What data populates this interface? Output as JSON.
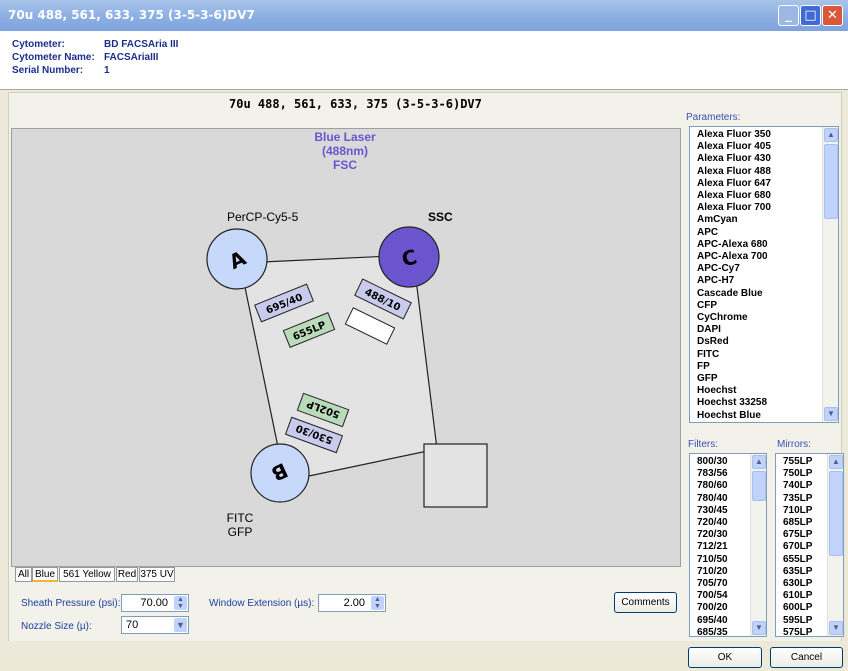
{
  "window": {
    "title": "70u 488, 561, 633, 375 (3-5-3-6)DV7",
    "min": "_",
    "max": "□",
    "close": "✕"
  },
  "info": [
    {
      "label": "Cytometer:",
      "value": "BD FACSAria III"
    },
    {
      "label": "Cytometer Name:",
      "value": "FACSAriaIII"
    },
    {
      "label": "Serial Number:",
      "value": "1"
    }
  ],
  "diagram": {
    "title": "70u 488, 561, 633, 375 (3-5-3-6)DV7",
    "laser_line1": "Blue Laser",
    "laser_line2": "(488nm)",
    "laser_line3": "FSC",
    "label_a": "PerCP-Cy5-5",
    "label_c": "SSC",
    "label_b1": "FITC",
    "label_b2": "GFP",
    "det_a": "A",
    "det_b": "B",
    "det_c": "C",
    "f_695": "695/40",
    "f_655": "655LP",
    "f_488": "488/10",
    "f_502": "502LP",
    "f_530": "530/30",
    "colors": {
      "det_light": "#c7d9fb",
      "det_dark": "#6a55cf",
      "laser": "#6a55cf",
      "filter_blue": "#c9cbec",
      "filter_green": "#b9dbb9"
    }
  },
  "params": {
    "label": "Parameters:",
    "items": [
      "Alexa Fluor 350",
      "Alexa Fluor 405",
      "Alexa Fluor 430",
      "Alexa Fluor 488",
      "Alexa Fluor 647",
      "Alexa Fluor 680",
      "Alexa Fluor 700",
      "AmCyan",
      "APC",
      "APC-Alexa 680",
      "APC-Alexa 700",
      "APC-Cy7",
      "APC-H7",
      "Cascade Blue",
      "CFP",
      "CyChrome",
      "DAPI",
      "DsRed",
      "FITC",
      "FP",
      "GFP",
      "Hoechst",
      "Hoechst 33258",
      "Hoechst Blue"
    ]
  },
  "filters": {
    "label": "Filters:",
    "items": [
      "800/30",
      "783/56",
      "780/60",
      "780/40",
      "730/45",
      "720/40",
      "720/30",
      "712/21",
      "710/50",
      "710/20",
      "705/70",
      "700/54",
      "700/20",
      "695/40",
      "685/35"
    ]
  },
  "mirrors": {
    "label": "Mirrors:",
    "items": [
      "755LP",
      "750LP",
      "740LP",
      "735LP",
      "710LP",
      "685LP",
      "675LP",
      "670LP",
      "655LP",
      "635LP",
      "630LP",
      "610LP",
      "600LP",
      "595LP",
      "575LP"
    ]
  },
  "tabs": [
    "All",
    "Blue",
    "561 Yellow",
    "Red",
    "375 UV"
  ],
  "form": {
    "sheath_label": "Sheath Pressure (psi):",
    "sheath_value": "70.00",
    "window_label": "Window Extension (µs):",
    "window_value": "2.00",
    "nozzle_label": "Nozzle Size (µ):",
    "nozzle_value": "70",
    "comments": "Comments"
  },
  "buttons": {
    "ok": "OK",
    "cancel": "Cancel"
  }
}
